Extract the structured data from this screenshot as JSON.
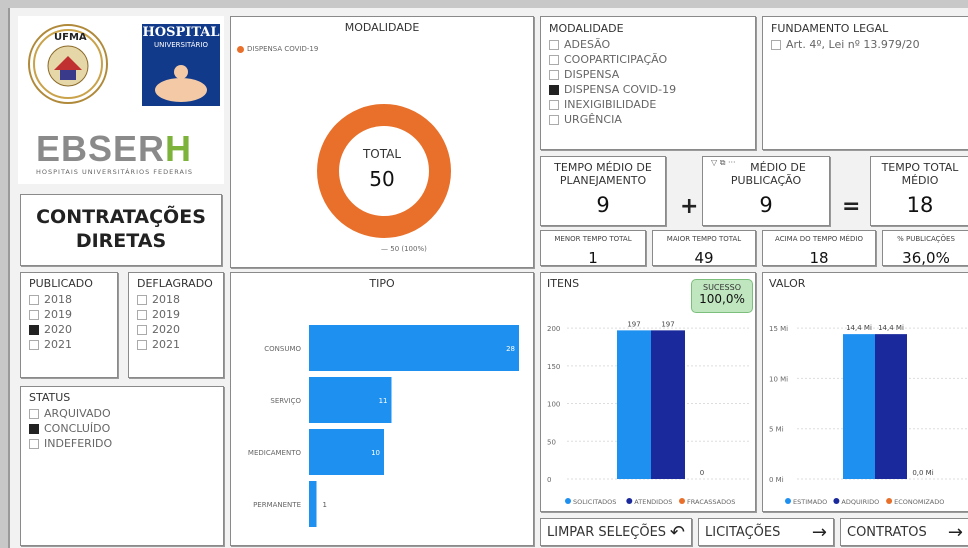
{
  "header": {
    "ufma_logo_text": "UFMA",
    "hospital_title": "HOSPITAL",
    "hospital_subtitle": "UNIVERSITÁRIO",
    "ebserh_brand": "EBSER",
    "ebserh_brand_h": "H",
    "ebserh_tagline": "HOSPITAIS UNIVERSITÁRIOS FEDERAIS",
    "page_title_line1": "CONTRATAÇÕES",
    "page_title_line2": "DIRETAS"
  },
  "modalidade_chart": {
    "title": "MODALIDADE",
    "legend": "DISPENSA COVID-19",
    "center_label": "TOTAL",
    "center_value": "50",
    "slice_label": "50 (100%)",
    "chart_data": {
      "type": "pie",
      "categories": [
        "DISPENSA COVID-19"
      ],
      "values": [
        50
      ]
    }
  },
  "modalidade_slicer": {
    "title": "MODALIDADE",
    "items": [
      {
        "label": "ADESÃO",
        "checked": false
      },
      {
        "label": "COOPARTICIPAÇÃO",
        "checked": false
      },
      {
        "label": "DISPENSA",
        "checked": false
      },
      {
        "label": "DISPENSA COVID-19",
        "checked": true
      },
      {
        "label": "INEXIGIBILIDADE",
        "checked": false
      },
      {
        "label": "URGÊNCIA",
        "checked": false
      }
    ]
  },
  "fundamento": {
    "title": "FUNDAMENTO LEGAL",
    "items": [
      {
        "label": "Art. 4º, Lei nº 13.979/20",
        "checked": false
      }
    ]
  },
  "kpis": {
    "planejamento_label1": "TEMPO MÉDIO DE",
    "planejamento_label2": "PLANEJAMENTO",
    "planejamento_value": "9",
    "publicacao_label1": "MÉDIO DE",
    "publicacao_label2": "PUBLICAÇÃO",
    "publicacao_value": "9",
    "total_label1": "TEMPO TOTAL",
    "total_label2": "MÉDIO",
    "total_value": "18",
    "plus": "+",
    "equals": "=",
    "menor_label": "MENOR TEMPO TOTAL",
    "menor_value": "1",
    "maior_label": "MAIOR TEMPO TOTAL",
    "maior_value": "49",
    "acima_label": "ACIMA DO TEMPO MÉDIO",
    "acima_value": "18",
    "pub_label": "% PUBLICAÇÕES",
    "pub_value": "36,0%"
  },
  "publicado": {
    "title": "PUBLICADO",
    "items": [
      {
        "label": "2018",
        "checked": false
      },
      {
        "label": "2019",
        "checked": false
      },
      {
        "label": "2020",
        "checked": true
      },
      {
        "label": "2021",
        "checked": false
      }
    ]
  },
  "deflagrado": {
    "title": "DEFLAGRADO",
    "items": [
      {
        "label": "2018",
        "checked": false
      },
      {
        "label": "2019",
        "checked": false
      },
      {
        "label": "2020",
        "checked": false
      },
      {
        "label": "2021",
        "checked": false
      }
    ]
  },
  "status": {
    "title": "STATUS",
    "items": [
      {
        "label": "ARQUIVADO",
        "checked": false
      },
      {
        "label": "CONCLUÍDO",
        "checked": true
      },
      {
        "label": "INDEFERIDO",
        "checked": false
      }
    ]
  },
  "tipo_chart": {
    "title": "TIPO",
    "chart_data": {
      "type": "bar",
      "orientation": "horizontal",
      "categories": [
        "CONSUMO",
        "SERVIÇO",
        "MEDICAMENTO",
        "PERMANENTE"
      ],
      "values": [
        28,
        11,
        10,
        1
      ],
      "xlim": [
        0,
        28
      ],
      "color": "#1e90f0"
    }
  },
  "itens_chart": {
    "title": "ITENS",
    "badge_label": "SUCESSO",
    "badge_value": "100,0%",
    "chart_data": {
      "type": "bar",
      "categories": [
        "SOLICITADOS",
        "ATENDIDOS",
        "FRACASSADOS"
      ],
      "values": [
        197,
        197,
        0
      ],
      "value_labels": [
        "197",
        "197",
        "0"
      ],
      "colors": [
        "#1e90f0",
        "#1a2a9c",
        "#e8702a"
      ],
      "ylim": [
        0,
        220
      ],
      "yticks": [
        0,
        50,
        100,
        150,
        200
      ],
      "ytick_labels": [
        "0",
        "50",
        "100",
        "150",
        "200"
      ]
    }
  },
  "valor_chart": {
    "title": "VALOR",
    "chart_data": {
      "type": "bar",
      "categories": [
        "ESTIMADO",
        "ADQUIRIDO",
        "ECONOMIZADO"
      ],
      "values": [
        14.4,
        14.4,
        0
      ],
      "value_labels": [
        "14,4 Mi",
        "14,4 Mi",
        "0,0 Mi"
      ],
      "colors": [
        "#1e90f0",
        "#1a2a9c",
        "#e8702a"
      ],
      "ylim": [
        0,
        16.5
      ],
      "yticks": [
        0,
        5,
        10,
        15
      ],
      "ytick_labels": [
        "0 Mi",
        "5 Mi",
        "10 Mi",
        "15 Mi"
      ]
    }
  },
  "buttons": {
    "limpar": "LIMPAR SELEÇÕES",
    "licitacoes": "LICITAÇÕES",
    "contratos": "CONTRATOS"
  }
}
